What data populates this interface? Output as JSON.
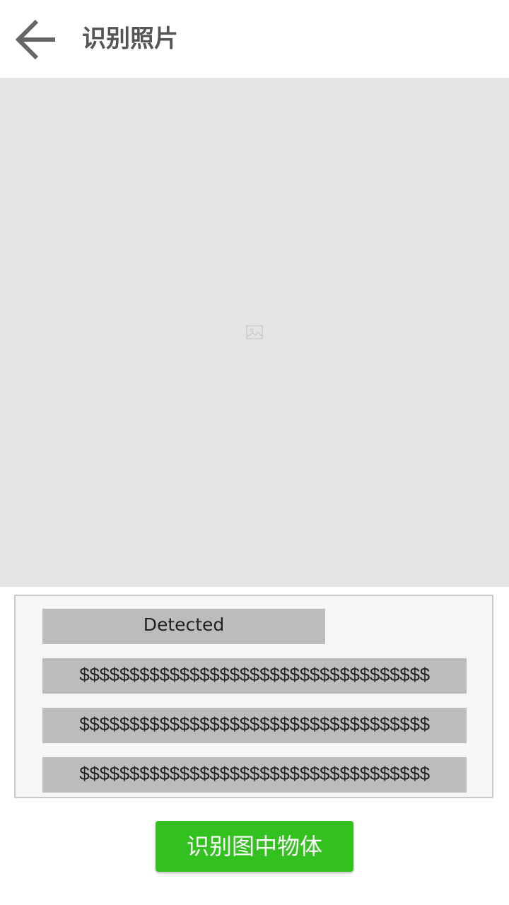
{
  "header": {
    "title": "识别照片",
    "back_icon": "arrow-left-icon"
  },
  "photo": {
    "placeholder_icon": "image-icon",
    "background": "#e4e4e4"
  },
  "results": {
    "status_label": "Detected",
    "rows": [
      "$$$$$$$$$$$$$$$$$$$$$$$$$$$$$$$$$$$",
      "$$$$$$$$$$$$$$$$$$$$$$$$$$$$$$$$$$$",
      "$$$$$$$$$$$$$$$$$$$$$$$$$$$$$$$$$$$"
    ]
  },
  "action": {
    "detect_label": "识别图中物体",
    "color": "#33c11f"
  }
}
